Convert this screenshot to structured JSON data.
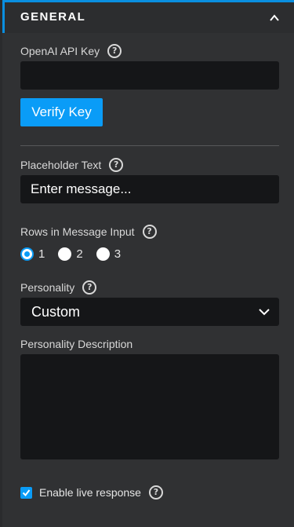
{
  "section": {
    "title": "GENERAL",
    "collapse_icon": "chevron-up-icon"
  },
  "api_key": {
    "label": "OpenAI API Key",
    "value": "",
    "placeholder": "",
    "help_icon": "question-circle-icon"
  },
  "verify_button": {
    "label": "Verify Key"
  },
  "placeholder_text": {
    "label": "Placeholder Text",
    "value": "Enter message...",
    "help_icon": "question-circle-icon"
  },
  "rows": {
    "label": "Rows in Message Input",
    "help_icon": "question-circle-icon",
    "options": [
      "1",
      "2",
      "3"
    ],
    "selected": "1"
  },
  "personality": {
    "label": "Personality",
    "selected": "Custom",
    "help_icon": "question-circle-icon"
  },
  "personality_description": {
    "label": "Personality Description",
    "value": ""
  },
  "live_response": {
    "label": "Enable live response",
    "checked": true,
    "help_icon": "question-circle-icon"
  },
  "colors": {
    "accent": "#0a9cf7",
    "background": "#303133",
    "input_bg": "#151618"
  }
}
